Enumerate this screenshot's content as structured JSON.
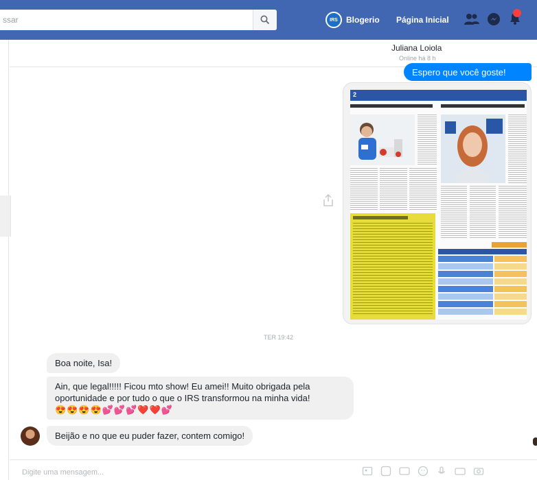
{
  "topbar": {
    "search_placeholder": "ssar",
    "user_name": "Blogerio",
    "avatar_initials": "IRS",
    "home_label": "Página Inicial"
  },
  "conversation": {
    "contact_name": "Juliana Loiola",
    "contact_status": "Online há 8 h",
    "sent_message": "Espero que você goste!",
    "timestamp": "TER 19:42",
    "received": [
      "Boa noite, Isa!",
      "Ain, que legal!!!!! Ficou mto show! Eu amei!! Muito obrigada pela oportunidade e por tudo o que o IRS transformou na minha vida!",
      "Beijão e no que eu puder fazer, contem comigo!"
    ],
    "emoji_line": "😍😍😍😍💕💕💕❤️❤️💕"
  },
  "newspaper": {
    "page_number": "2"
  },
  "composer": {
    "placeholder": "Digite uma mensagem..."
  },
  "colors": {
    "topbar_blue": "#4267b2",
    "sent_bubble": "#0084ff",
    "received_bubble": "#f1f0f0",
    "newspaper_yellow": "#e8dc3d"
  }
}
